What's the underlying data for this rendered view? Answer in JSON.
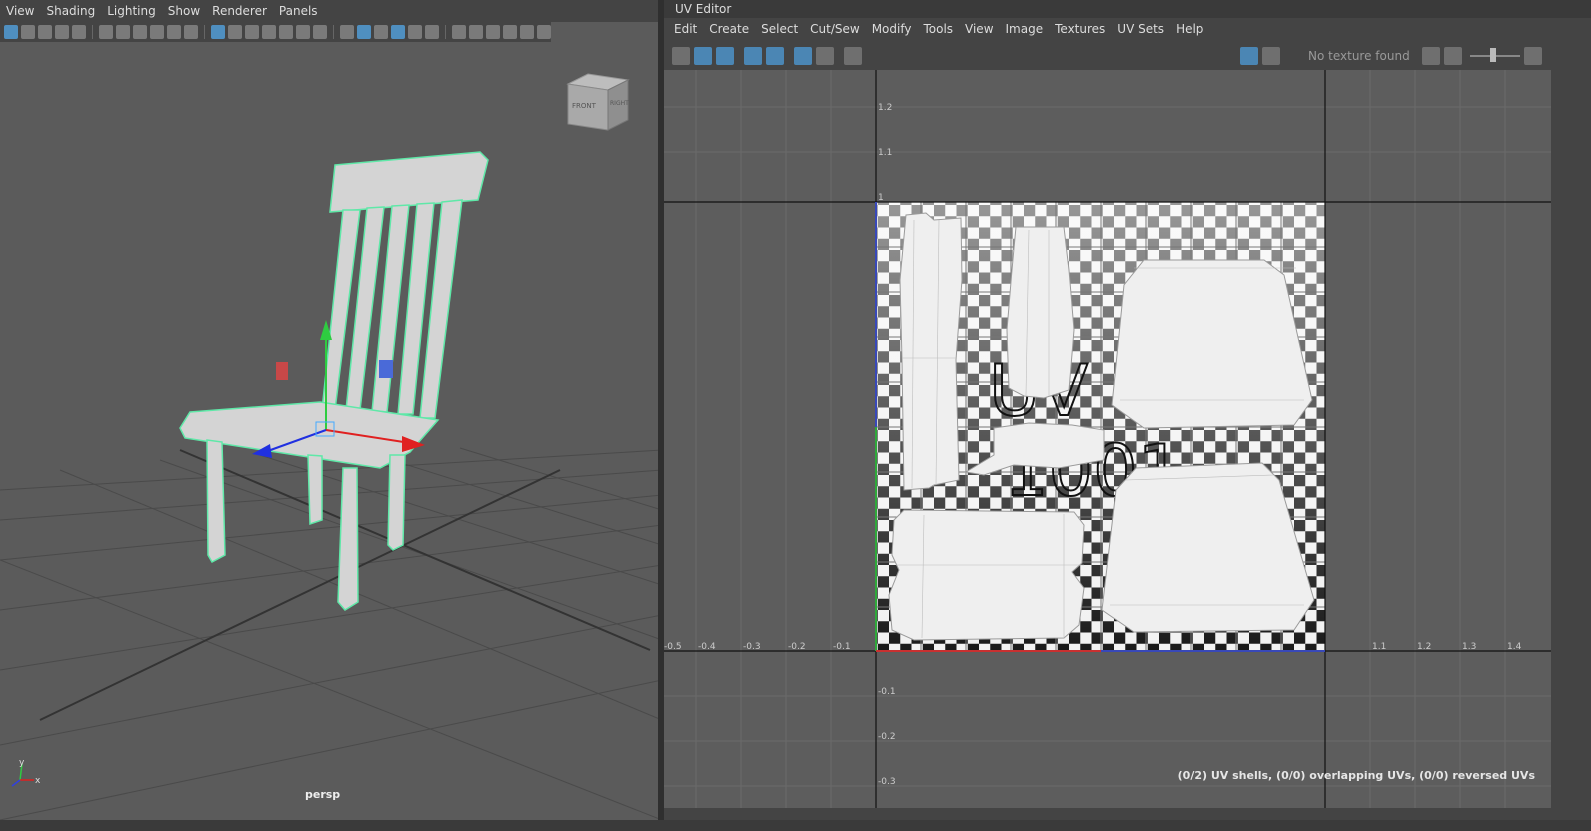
{
  "viewport": {
    "menu": [
      "View",
      "Shading",
      "Lighting",
      "Show",
      "Renderer",
      "Panels"
    ],
    "camera_label": "persp",
    "view_cube": {
      "front": "FRONT",
      "right": "RIGHT"
    },
    "axis": {
      "y": "y",
      "x": "x",
      "z": "z"
    }
  },
  "uv_editor": {
    "title": "UV Editor",
    "menu": [
      "Edit",
      "Create",
      "Select",
      "Cut/Sew",
      "Modify",
      "Tools",
      "View",
      "Image",
      "Textures",
      "UV Sets",
      "Help"
    ],
    "texture_status": "No texture found",
    "tile_label": "1001",
    "tile_text_top": "UV",
    "x_ticks": [
      "-0.5",
      "-0.4",
      "-0.3",
      "-0.2",
      "-0.1",
      "1.1",
      "1.2",
      "1.3",
      "1.4"
    ],
    "y_ticks": [
      "1.2",
      "1.1",
      "1",
      "-0.1",
      "-0.2",
      "-0.3"
    ],
    "status": "(0/2) UV shells, (0/0) overlapping UVs, (0/0) reversed UVs"
  }
}
